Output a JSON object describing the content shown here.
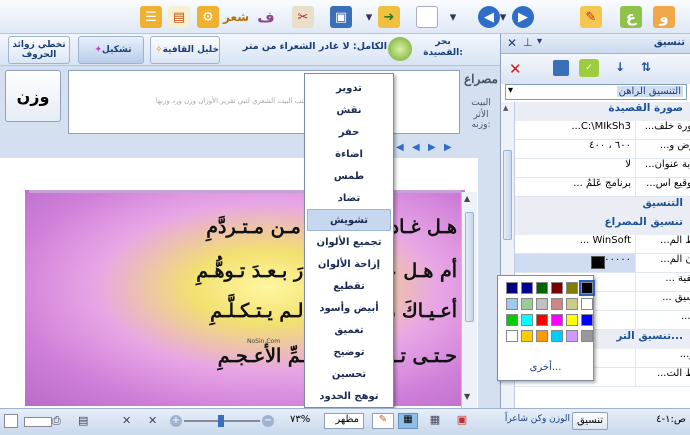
{
  "toolbar": {
    "icons": [
      "new-doc-icon",
      "open-folder-icon",
      "save-icon",
      "tools-icon",
      "format-icon",
      "poetry-icon",
      "settings-icon",
      "document-icon",
      "export-icon",
      "wazn-logo-icon",
      "back-icon",
      "forward-icon",
      "print-icon"
    ],
    "shear_label": "شعر"
  },
  "ribbon": {
    "buttons": [
      {
        "name": "remove-letter-extras",
        "label": "تخطي زوائد الحروف"
      },
      {
        "name": "tashkeel",
        "label": "تشكيل"
      },
      {
        "name": "qafiya",
        "label": "خليل القافية"
      }
    ],
    "bahr_label": "بحر القصيدة:",
    "bahr_value": "الكامل: لا غادر الشعراء من متر",
    "misra_label": "مصراع",
    "bayt_label": "البيت",
    "athar_label": "الأثر وزنه:"
  },
  "editor": {
    "wazn_button": "وزن",
    "placeholder": "اكتب البيت الشعري لتبي تقرير الأوزان وزن ورد وزنها"
  },
  "poem": {
    "lines": [
      "هـل غـادرَ الشُّعـراءُ مـن مـتـردَّمِ",
      "أم هـل عرفـتَ الـدَّارَ بـعـدَ تـوهُّـمِ",
      "أعـيـاكَ رسمُ الـدارِ لـم يـتـكـلَّـمِ",
      "حـتـى تـكـلَّمَ كـالأصـمِّ الأعـجـمِ"
    ],
    "watermark": "NoSin.Com"
  },
  "menu": {
    "items": [
      "تدوير",
      "نقش",
      "حفر",
      "اضاءة",
      "طمس",
      "تضاد",
      "تشويش",
      "تجميع الألوان",
      "إزاحة الألوان",
      "تقطيع",
      "أبيض وأسود",
      "تغميق",
      "توضيح",
      "تحسين",
      "توهج الحدود"
    ],
    "selected": 6
  },
  "panel": {
    "title": "تنسيق",
    "theme_value": "التنسيق الراهن",
    "categories": {
      "poem_image": "صورة القصيدة",
      "format": "التنسيق",
      "format_misra": "تنسيق المصراع",
      "format_bottom": "تنسيق التر..."
    },
    "rows": [
      {
        "name": "صورة خلف...",
        "value": "C:\\MIkSh3..."
      },
      {
        "name": "عرض و...",
        "value": "٦٠٠ ، ٤٠٠"
      },
      {
        "name": "كتابة عنوان...",
        "value": "لا"
      },
      {
        "name": "التوقيع أس...",
        "value": "برنامج عَلَمُ ..."
      },
      {
        "name": "خط الم...",
        "value": "WinSoft ..."
      },
      {
        "name": "لون الم...",
        "value": "٠٠٠٠٠٠"
      },
      {
        "name": "خلفية ...",
        "value": ""
      },
      {
        "name": "تنسيق ...",
        "value": ""
      },
      {
        "name": "مؤ...",
        "value": ""
      },
      {
        "name": "حر...",
        "value": ""
      },
      {
        "name": "خط الت...",
        "value": ""
      }
    ],
    "bottom_label": "الوزن وكن شاعراً",
    "bottom_tab": "تنسيق"
  },
  "colors": {
    "swatches": [
      "#000080",
      "#000099",
      "#006400",
      "#7a0000",
      "#808000",
      "#000000",
      "#a0c8f0",
      "#99cc99",
      "#c0c0c0",
      "#cc8888",
      "#cccc88",
      "#ffffff",
      "#00cc00",
      "#00ffff",
      "#ff0000",
      "#ff00ff",
      "#ffff00",
      "#0000ff",
      "#ffffff",
      "#ffcc00",
      "#ff9900",
      "#00ccff",
      "#cc99ff",
      "#999999"
    ],
    "more_label": "أخرى..."
  },
  "status": {
    "zoom": "٧٣%",
    "view_label": "مظهر",
    "page_label": "ص:١-٤"
  }
}
